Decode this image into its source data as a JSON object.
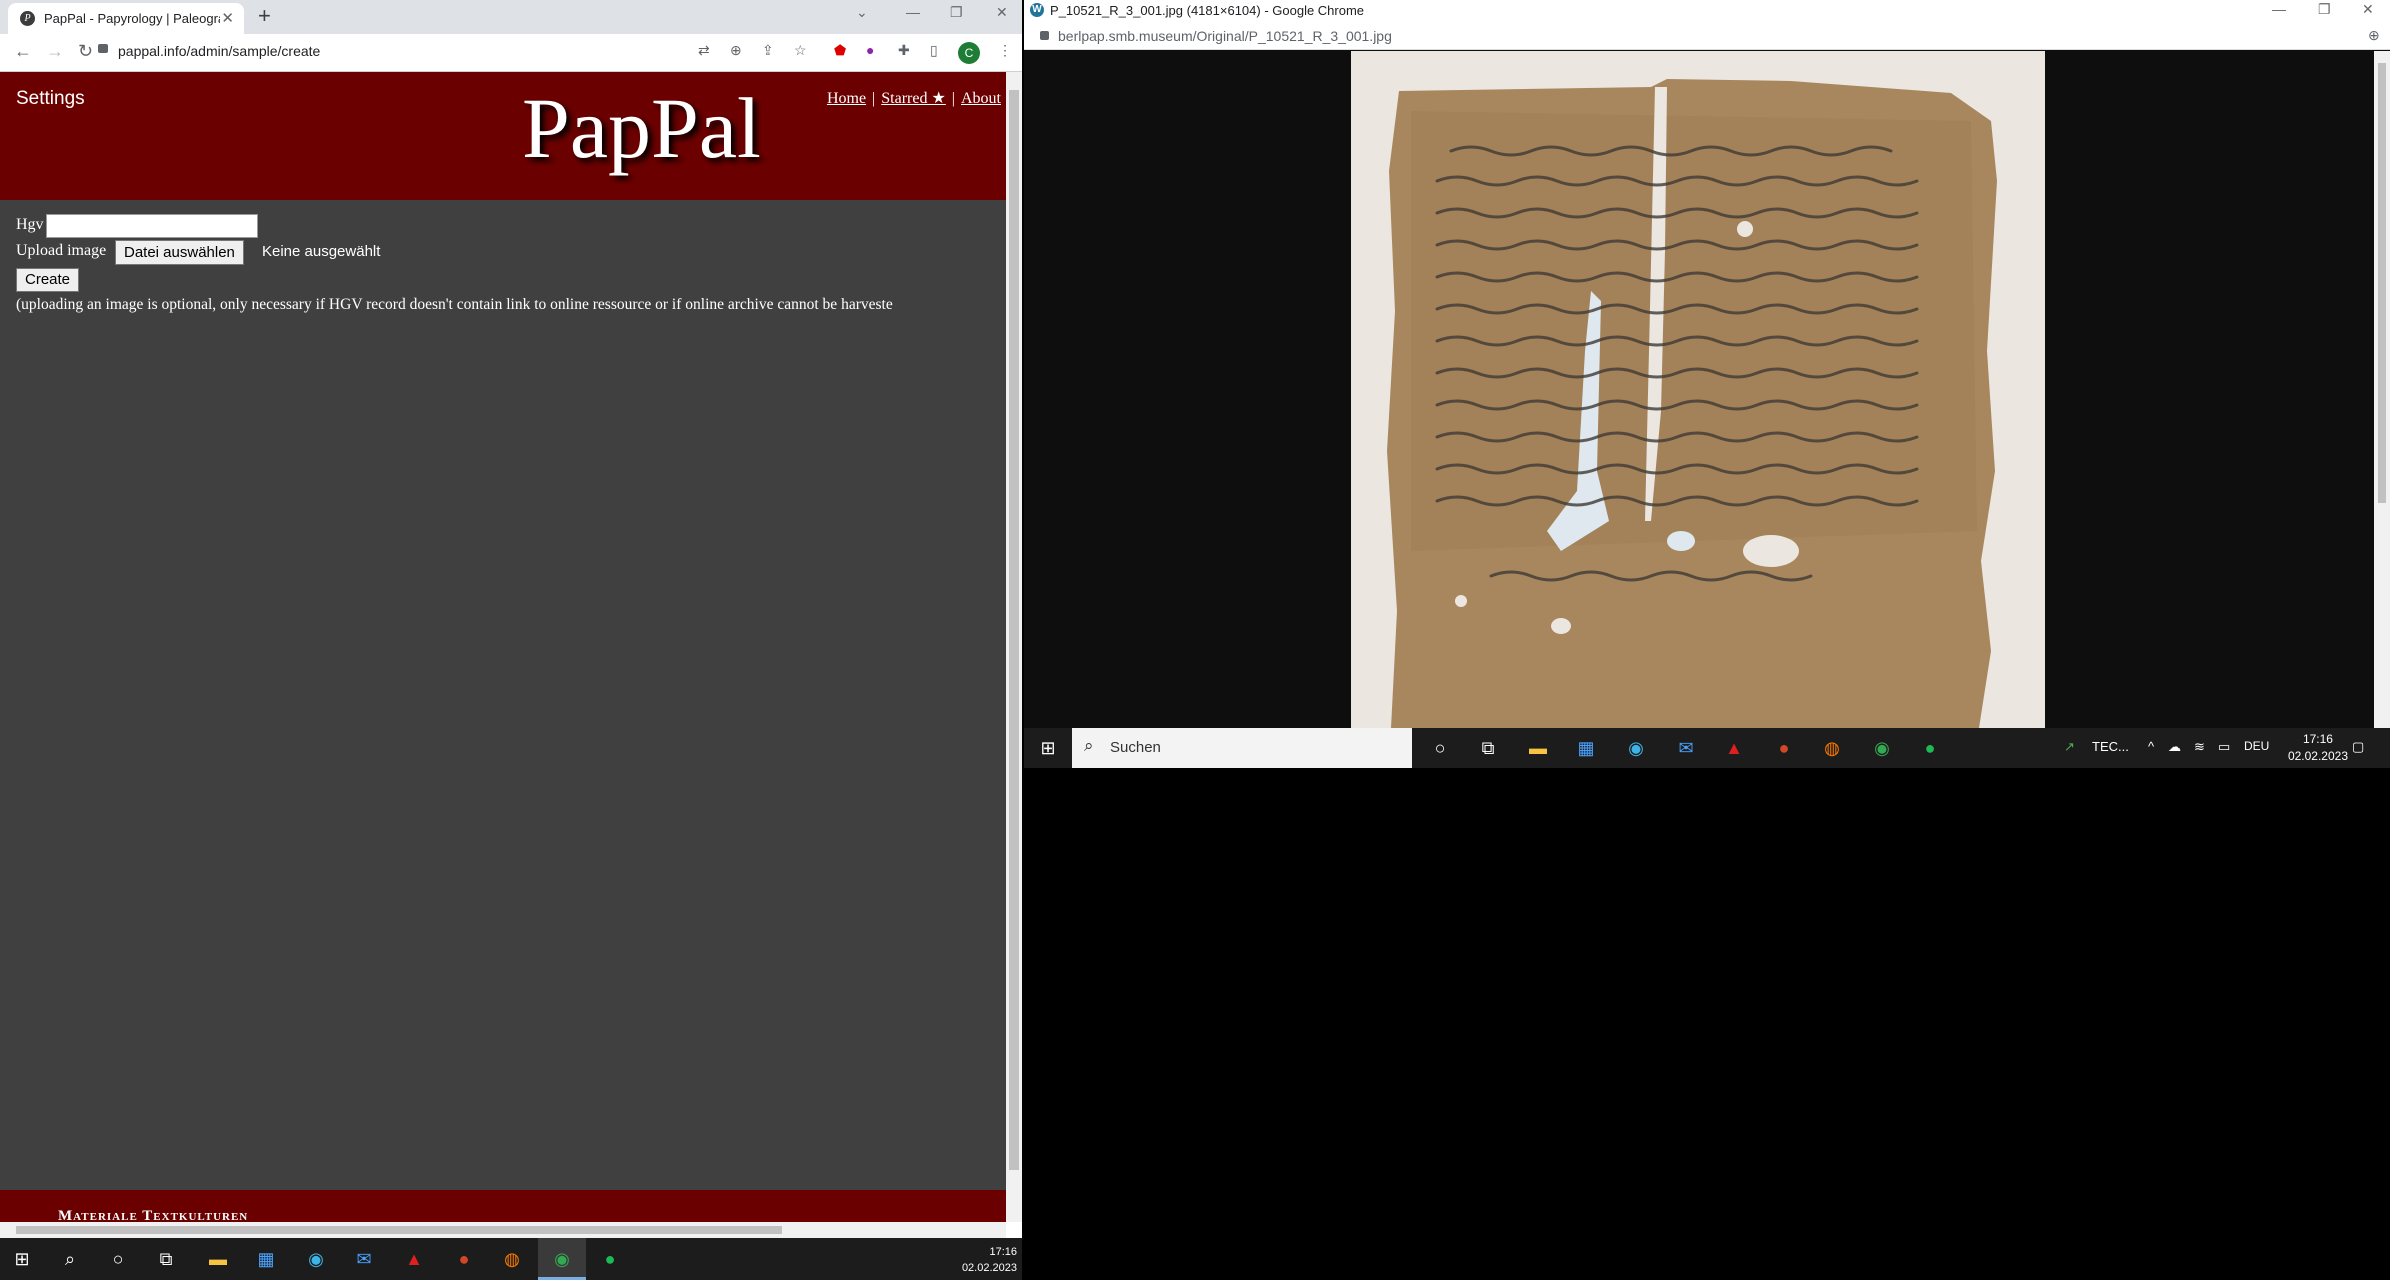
{
  "left_window": {
    "tab_title": "PapPal - Papyrology | Paleograph",
    "url": "pappal.info/admin/sample/create",
    "avatar_letter": "C",
    "site": {
      "settings_label": "Settings",
      "logo_text": "PapPal",
      "nav": {
        "home": "Home",
        "separator": "|",
        "starred": "Starred ★",
        "about": "About"
      },
      "form": {
        "hgv_label": "Hgv",
        "hgv_value": "",
        "upload_label": "Upload image",
        "file_button": "Datei auswählen",
        "file_status": "Keine ausgewählt",
        "create_button": "Create",
        "note": "(uploading an image is optional, only necessary if HGV record doesn't contain link to online ressource or if online archive cannot be harveste"
      },
      "footer_text": "Materiale Textkulturen"
    },
    "taskbar": {
      "time": "17:16",
      "date": "02.02.2023"
    }
  },
  "right_window": {
    "title": "P_10521_R_3_001.jpg (4181×6104) - Google Chrome",
    "url": "berlpap.smb.museum/Original/P_10521_R_3_001.jpg",
    "image_subject": "papyrus-fragment",
    "taskbar": {
      "search_placeholder": "Suchen",
      "tray_app": "TEC...",
      "language": "DEU",
      "time": "17:16",
      "date": "02.02.2023"
    }
  },
  "colors": {
    "header": "#6b0000",
    "page_bg": "#404040",
    "papyrus": "#a8875e"
  }
}
